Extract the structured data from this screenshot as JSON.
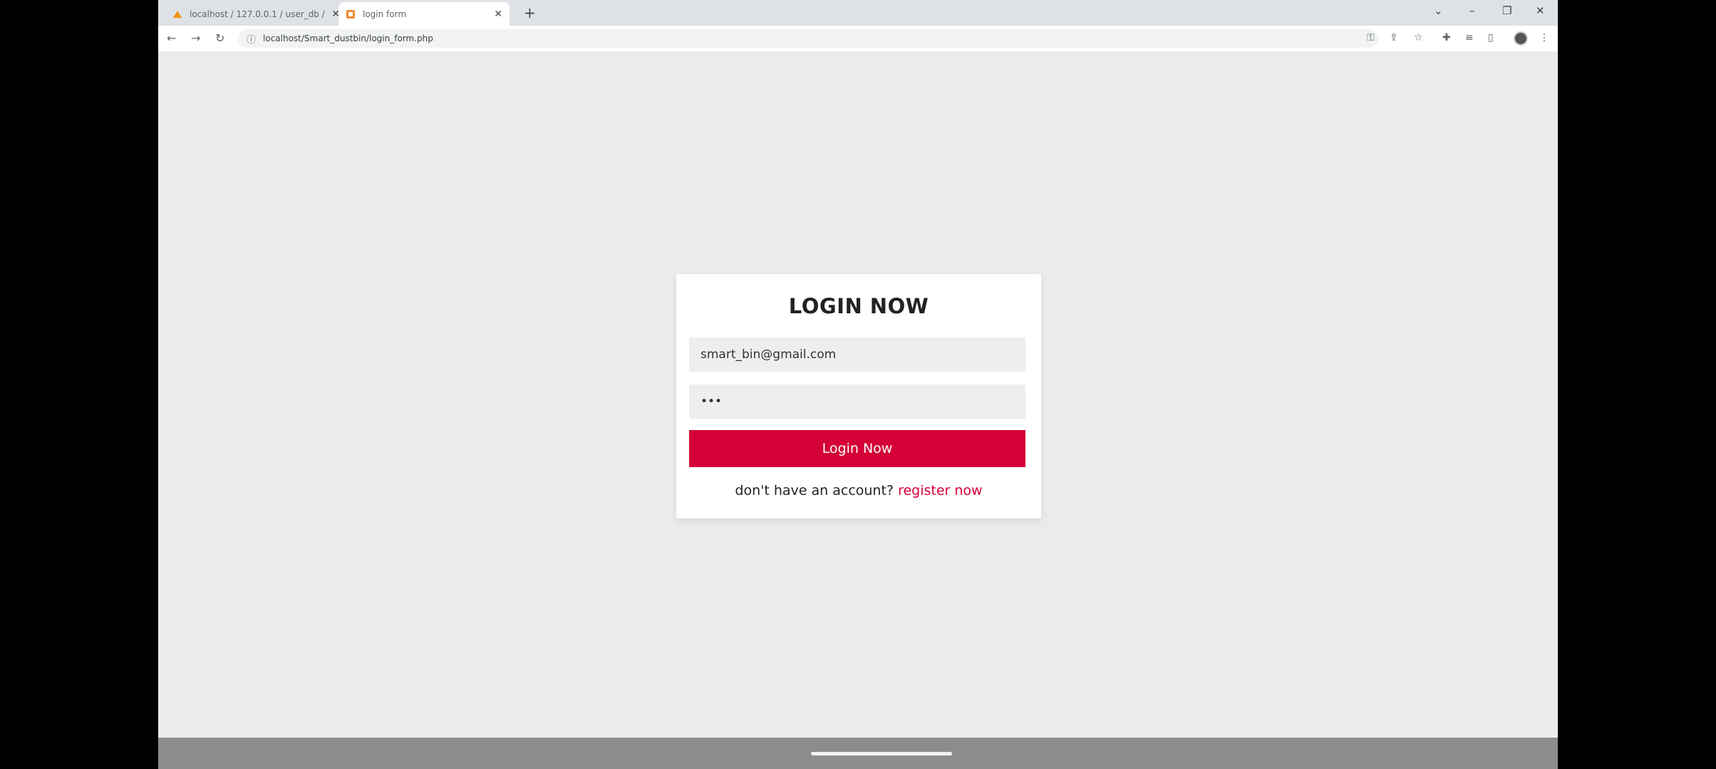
{
  "browser": {
    "tabs": [
      {
        "title": "localhost / 127.0.0.1 / user_db / ...",
        "active": false
      },
      {
        "title": "login form",
        "active": true
      }
    ],
    "url": "localhost/Smart_dustbin/login_form.php"
  },
  "login": {
    "heading": "LOGIN NOW",
    "email_value": "smart_bin@gmail.com",
    "password_value": "•••",
    "submit_label": "Login Now",
    "register_prompt": "don't have an account?",
    "register_link": "register now"
  },
  "colors": {
    "accent": "#d40036",
    "page_bg": "#ebebe9",
    "card_bg": "#ffffff",
    "field_bg": "#eeeeee"
  }
}
